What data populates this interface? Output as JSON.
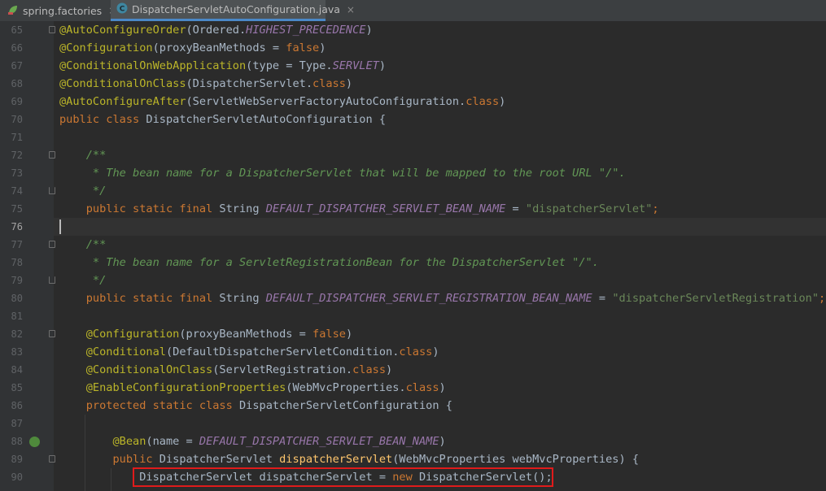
{
  "tabs": [
    {
      "label": "spring.factories",
      "icon": "spring-file-icon",
      "close": "×",
      "active": false
    },
    {
      "label": "DispatcherServletAutoConfiguration.java",
      "icon": "java-class-icon",
      "close": "×",
      "active": true
    }
  ],
  "editor": {
    "current_line": 76,
    "highlighted_line": 90,
    "lines": [
      {
        "n": "65"
      },
      {
        "n": "66"
      },
      {
        "n": "67"
      },
      {
        "n": "68"
      },
      {
        "n": "69"
      },
      {
        "n": "70"
      },
      {
        "n": "71"
      },
      {
        "n": "72"
      },
      {
        "n": "73"
      },
      {
        "n": "74"
      },
      {
        "n": "75"
      },
      {
        "n": "76"
      },
      {
        "n": "77"
      },
      {
        "n": "78"
      },
      {
        "n": "79"
      },
      {
        "n": "80"
      },
      {
        "n": "81"
      },
      {
        "n": "82"
      },
      {
        "n": "83"
      },
      {
        "n": "84"
      },
      {
        "n": "85"
      },
      {
        "n": "86"
      },
      {
        "n": "87"
      },
      {
        "n": "88"
      },
      {
        "n": "89"
      },
      {
        "n": "90"
      }
    ],
    "code": {
      "l65": {
        "a": "@AutoConfigureOrder",
        "b": "(Ordered.",
        "c": "HIGHEST_PRECEDENCE",
        "d": ")"
      },
      "l66": {
        "a": "@Configuration",
        "b": "(proxyBeanMethods = ",
        "c": "false",
        "d": ")"
      },
      "l67": {
        "a": "@ConditionalOnWebApplication",
        "b": "(type = Type.",
        "c": "SERVLET",
        "d": ")"
      },
      "l68": {
        "a": "@ConditionalOnClass",
        "b": "(DispatcherServlet.",
        "c": "class",
        "d": ")"
      },
      "l69": {
        "a": "@AutoConfigureAfter",
        "b": "(ServletWebServerFactoryAutoConfiguration.",
        "c": "class",
        "d": ")"
      },
      "l70": {
        "a": "public class ",
        "b": "DispatcherServletAutoConfiguration {"
      },
      "l72": {
        "a": "    /**"
      },
      "l73": {
        "a": "     * The bean name for a DispatcherServlet that will be mapped to the root URL \"/\"."
      },
      "l74": {
        "a": "     */"
      },
      "l75": {
        "a": "    public static final ",
        "b": "String ",
        "c": "DEFAULT_DISPATCHER_SERVLET_BEAN_NAME",
        "d": " = ",
        "e": "\"dispatcherServlet\"",
        "f": ";"
      },
      "l77": {
        "a": "    /**"
      },
      "l78": {
        "a": "     * The bean name for a ServletRegistrationBean for the DispatcherServlet \"/\"."
      },
      "l79": {
        "a": "     */"
      },
      "l80": {
        "a": "    public static final ",
        "b": "String ",
        "c": "DEFAULT_DISPATCHER_SERVLET_REGISTRATION_BEAN_NAME",
        "d": " = ",
        "e": "\"dispatcherServletRegistration\"",
        "f": ";"
      },
      "l82": {
        "a": "    @Configuration",
        "b": "(proxyBeanMethods = ",
        "c": "false",
        "d": ")"
      },
      "l83": {
        "a": "    @Conditional",
        "b": "(DefaultDispatcherServletCondition.",
        "c": "class",
        "d": ")"
      },
      "l84": {
        "a": "    @ConditionalOnClass",
        "b": "(ServletRegistration.",
        "c": "class",
        "d": ")"
      },
      "l85": {
        "a": "    @EnableConfigurationProperties",
        "b": "(WebMvcProperties.",
        "c": "class",
        "d": ")"
      },
      "l86": {
        "a": "    protected static class ",
        "b": "DispatcherServletConfiguration {"
      },
      "l88": {
        "a": "        @Bean",
        "b": "(name = ",
        "c": "DEFAULT_DISPATCHER_SERVLET_BEAN_NAME",
        "d": ")"
      },
      "l89": {
        "a": "        public ",
        "b": "DispatcherServlet ",
        "c": "dispatcherServlet",
        "d": "(WebMvcProperties webMvcProperties) {"
      },
      "l90": {
        "a": "            DispatcherServlet dispatcherServlet = ",
        "b": "new ",
        "c": "DispatcherServlet();"
      }
    }
  },
  "colors": {
    "background": "#2b2b2b",
    "keyword": "#cc7832",
    "annotation": "#bbb529",
    "string": "#6a8759",
    "constant": "#9876aa",
    "comment": "#629755",
    "method": "#ffc66d",
    "highlight_box": "#e01b1b"
  }
}
